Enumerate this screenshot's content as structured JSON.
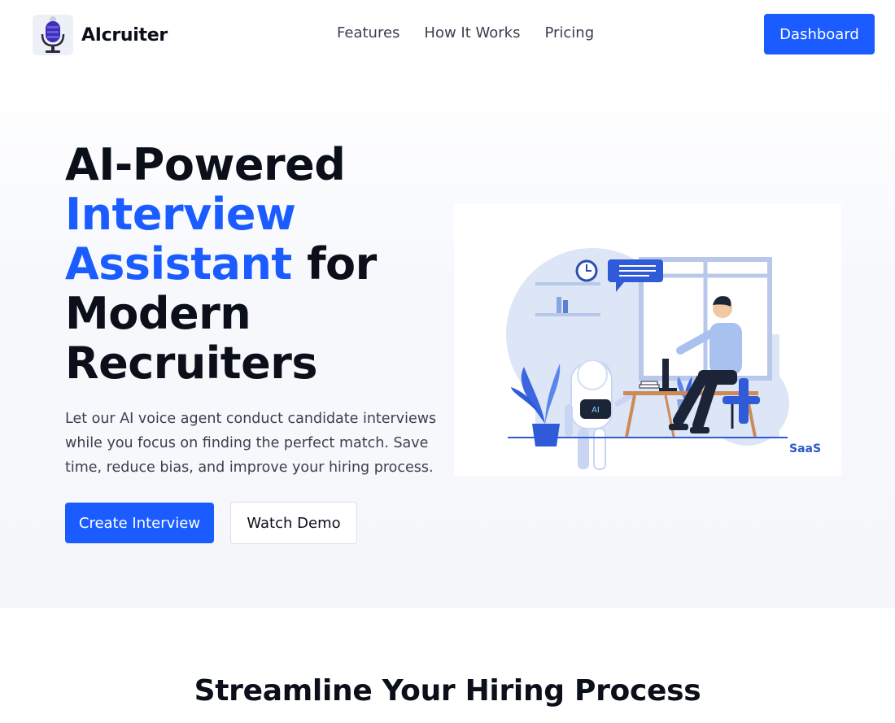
{
  "header": {
    "brand": "AIcruiter",
    "nav": [
      "Features",
      "How It Works",
      "Pricing"
    ],
    "dashboard_label": "Dashboard"
  },
  "hero": {
    "headline_line1": "AI-Powered",
    "headline_accent": "Interview Assistant",
    "headline_tail": "for Modern Recruiters",
    "lede": "Let our AI voice agent conduct candidate interviews while you focus on finding the perfect match. Save time, reduce bias, and improve your hiring process.",
    "primary_cta": "Create Interview",
    "secondary_cta": "Watch Demo",
    "illustration": {
      "robot_screen_text": "AI",
      "tag": "SaaS"
    }
  },
  "section": {
    "title": "Streamline Your Hiring Process"
  },
  "colors": {
    "accent": "#1a5cff",
    "text": "#0b0f19",
    "muted": "#3a4050"
  }
}
